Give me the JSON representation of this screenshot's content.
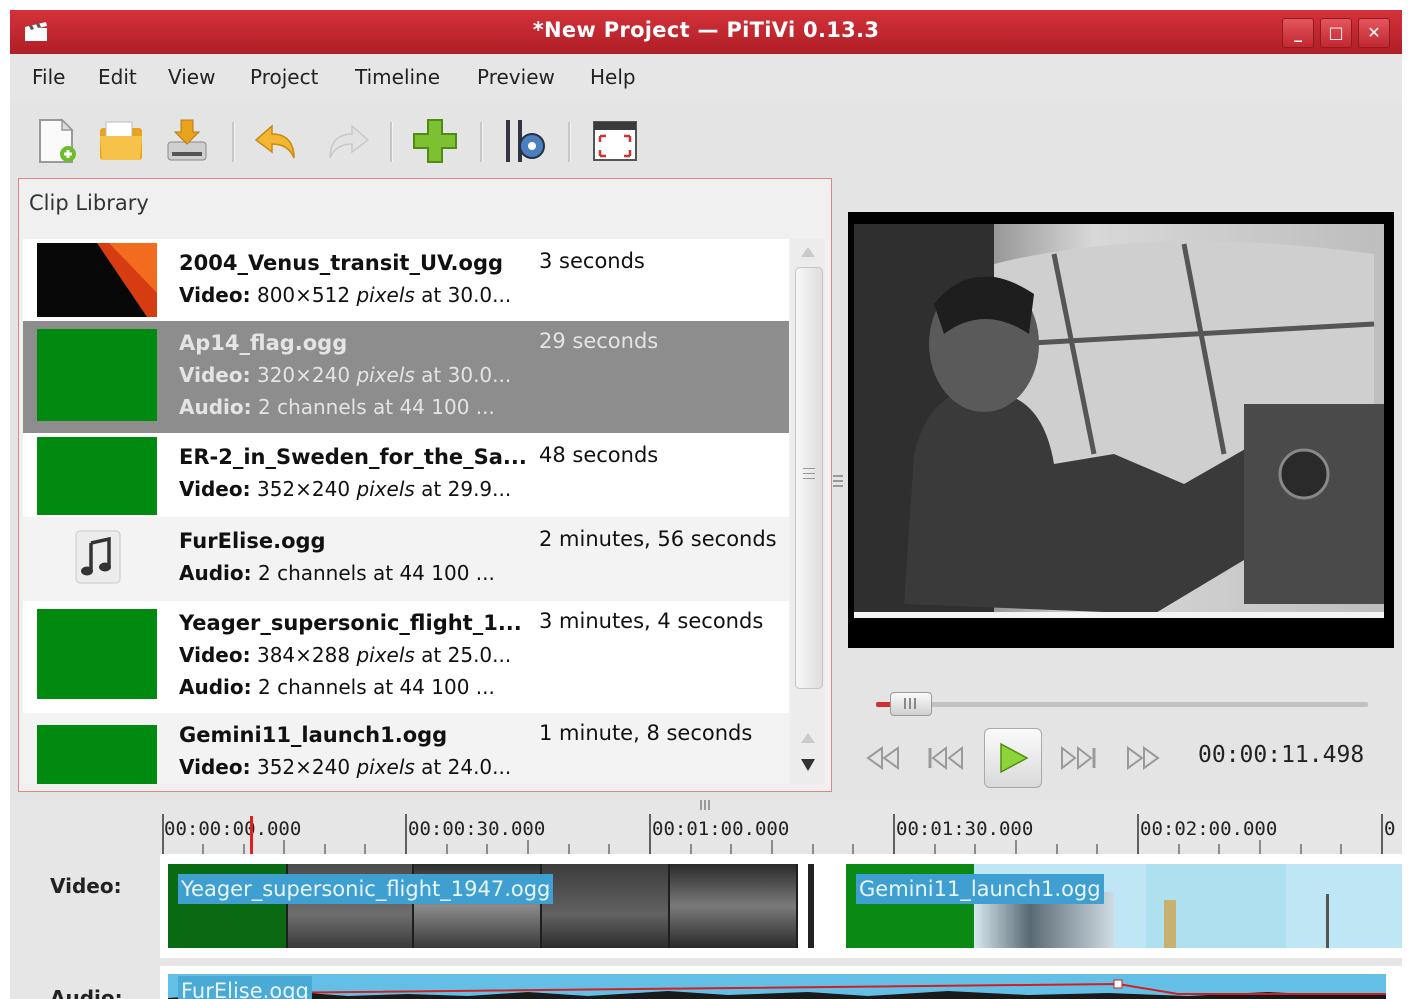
{
  "window": {
    "title": "*New Project — PiTiVi 0.13.3",
    "controls": {
      "minimize": "_",
      "maximize": "□",
      "close": "✕"
    }
  },
  "menu": {
    "items": [
      {
        "label": "File"
      },
      {
        "label": "Edit"
      },
      {
        "label": "View"
      },
      {
        "label": "Project"
      },
      {
        "label": "Timeline"
      },
      {
        "label": "Preview"
      },
      {
        "label": "Help"
      }
    ]
  },
  "toolbar": {
    "buttons": [
      "new-project-icon",
      "open-project-icon",
      "save-project-icon",
      "undo-icon",
      "redo-icon",
      "import-clips-icon",
      "project-settings-icon",
      "fullscreen-icon"
    ]
  },
  "clip_library": {
    "title": "Clip Library",
    "clips": [
      {
        "name": "2004_Venus_transit_UV.ogg",
        "duration": "3 seconds",
        "video_label": "Video:",
        "video_dims": "800×512",
        "video_unit": "pixels",
        "video_rate": "at 30.0..."
      },
      {
        "name": "Ap14_flag.ogg",
        "duration": "29 seconds",
        "video_label": "Video:",
        "video_dims": "320×240",
        "video_unit": "pixels",
        "video_rate": "at 30.0...",
        "audio_label": "Audio:",
        "audio_info": "2 channels at 44 100 ..."
      },
      {
        "name": "ER-2_in_Sweden_for_the_Sa...",
        "duration": "48 seconds",
        "video_label": "Video:",
        "video_dims": "352×240",
        "video_unit": "pixels",
        "video_rate": "at 29.9..."
      },
      {
        "name": "FurElise.ogg",
        "duration": "2 minutes, 56 seconds",
        "audio_label": "Audio:",
        "audio_info": "2 channels at 44 100 ..."
      },
      {
        "name": "Yeager_supersonic_flight_1...",
        "duration": "3 minutes, 4 seconds",
        "video_label": "Video:",
        "video_dims": "384×288",
        "video_unit": "pixels",
        "video_rate": "at 25.0...",
        "audio_label": "Audio:",
        "audio_info": "2 channels at 44 100 ..."
      },
      {
        "name": "Gemini11_launch1.ogg",
        "duration": "1 minute, 8 seconds",
        "video_label": "Video:",
        "video_dims": "352×240",
        "video_unit": "pixels",
        "video_rate": "at 24.0..."
      }
    ]
  },
  "viewer": {
    "timecode": "00:00:11.498",
    "position_fraction": 0.06,
    "buttons": [
      "rewind-icon",
      "previous-frame-icon",
      "play-icon",
      "next-frame-icon",
      "fast-forward-icon"
    ]
  },
  "timeline": {
    "ruler_labels": [
      "00:00:00.000",
      "00:00:30.000",
      "00:01:00.000",
      "00:01:30.000",
      "00:02:00.000",
      "0"
    ],
    "tracks": {
      "video_label": "Video:",
      "audio_label": "Audio:"
    },
    "clips": {
      "video_1": "Yeager_supersonic_flight_1947.ogg",
      "video_2": "Gemini11_launch1.ogg",
      "audio_1": "FurElise.ogg"
    }
  },
  "colors": {
    "titlebar": "#c0262e",
    "selection": "#8d8d8d",
    "thumb_green": "#008a10",
    "clip_label": "#3e9fd0"
  }
}
